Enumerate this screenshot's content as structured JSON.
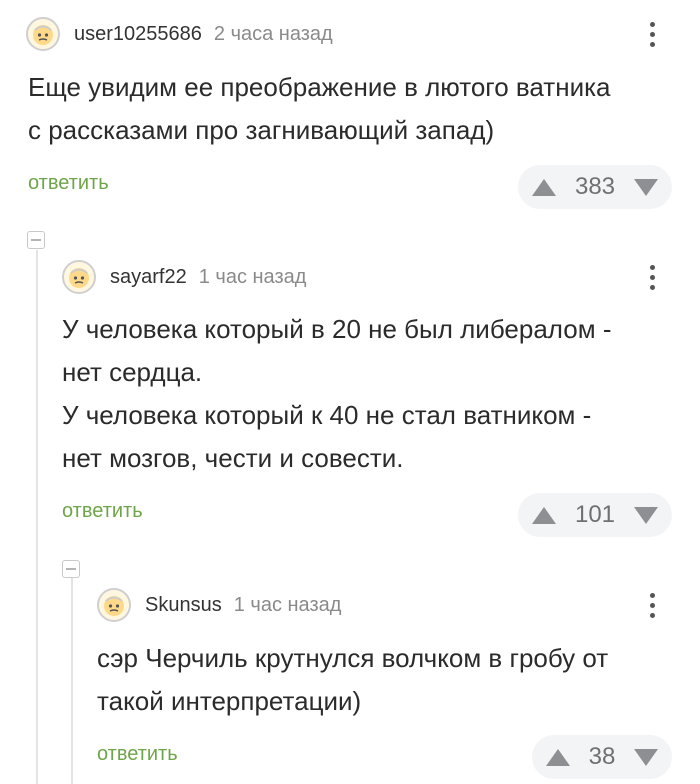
{
  "comments": [
    {
      "username": "user10255686",
      "time": "2 часа назад",
      "text": "Еще увидим ее преображение в лютого ватника\nс рассказами про загнивающий запад)",
      "reply_label": "ответить",
      "rating": "383"
    },
    {
      "username": "sayarf22",
      "time": "1 час назад",
      "text": "У человека который в 20 не был либералом -\nнет сердца.\nУ человека который к 40 не стал ватником -\nнет мозгов, чести и совести.",
      "reply_label": "ответить",
      "rating": "101"
    },
    {
      "username": "Skunsus",
      "time": "1 час назад",
      "text": "сэр Черчиль крутнулся волчком в гробу от\nтакой интерпретации)",
      "reply_label": "ответить",
      "rating": "38"
    }
  ],
  "icons": {
    "avatar": "default-avatar-icon",
    "menu": "more-vertical-icon",
    "upvote": "arrow-up-icon",
    "downvote": "arrow-down-icon",
    "collapse": "collapse-thread-icon"
  },
  "colors": {
    "reply_link": "#6fa54a",
    "vote_background": "#f3f4f6",
    "vote_arrow": "#8d8f93",
    "username": "#333333",
    "timestamp": "#8a8a8a"
  }
}
